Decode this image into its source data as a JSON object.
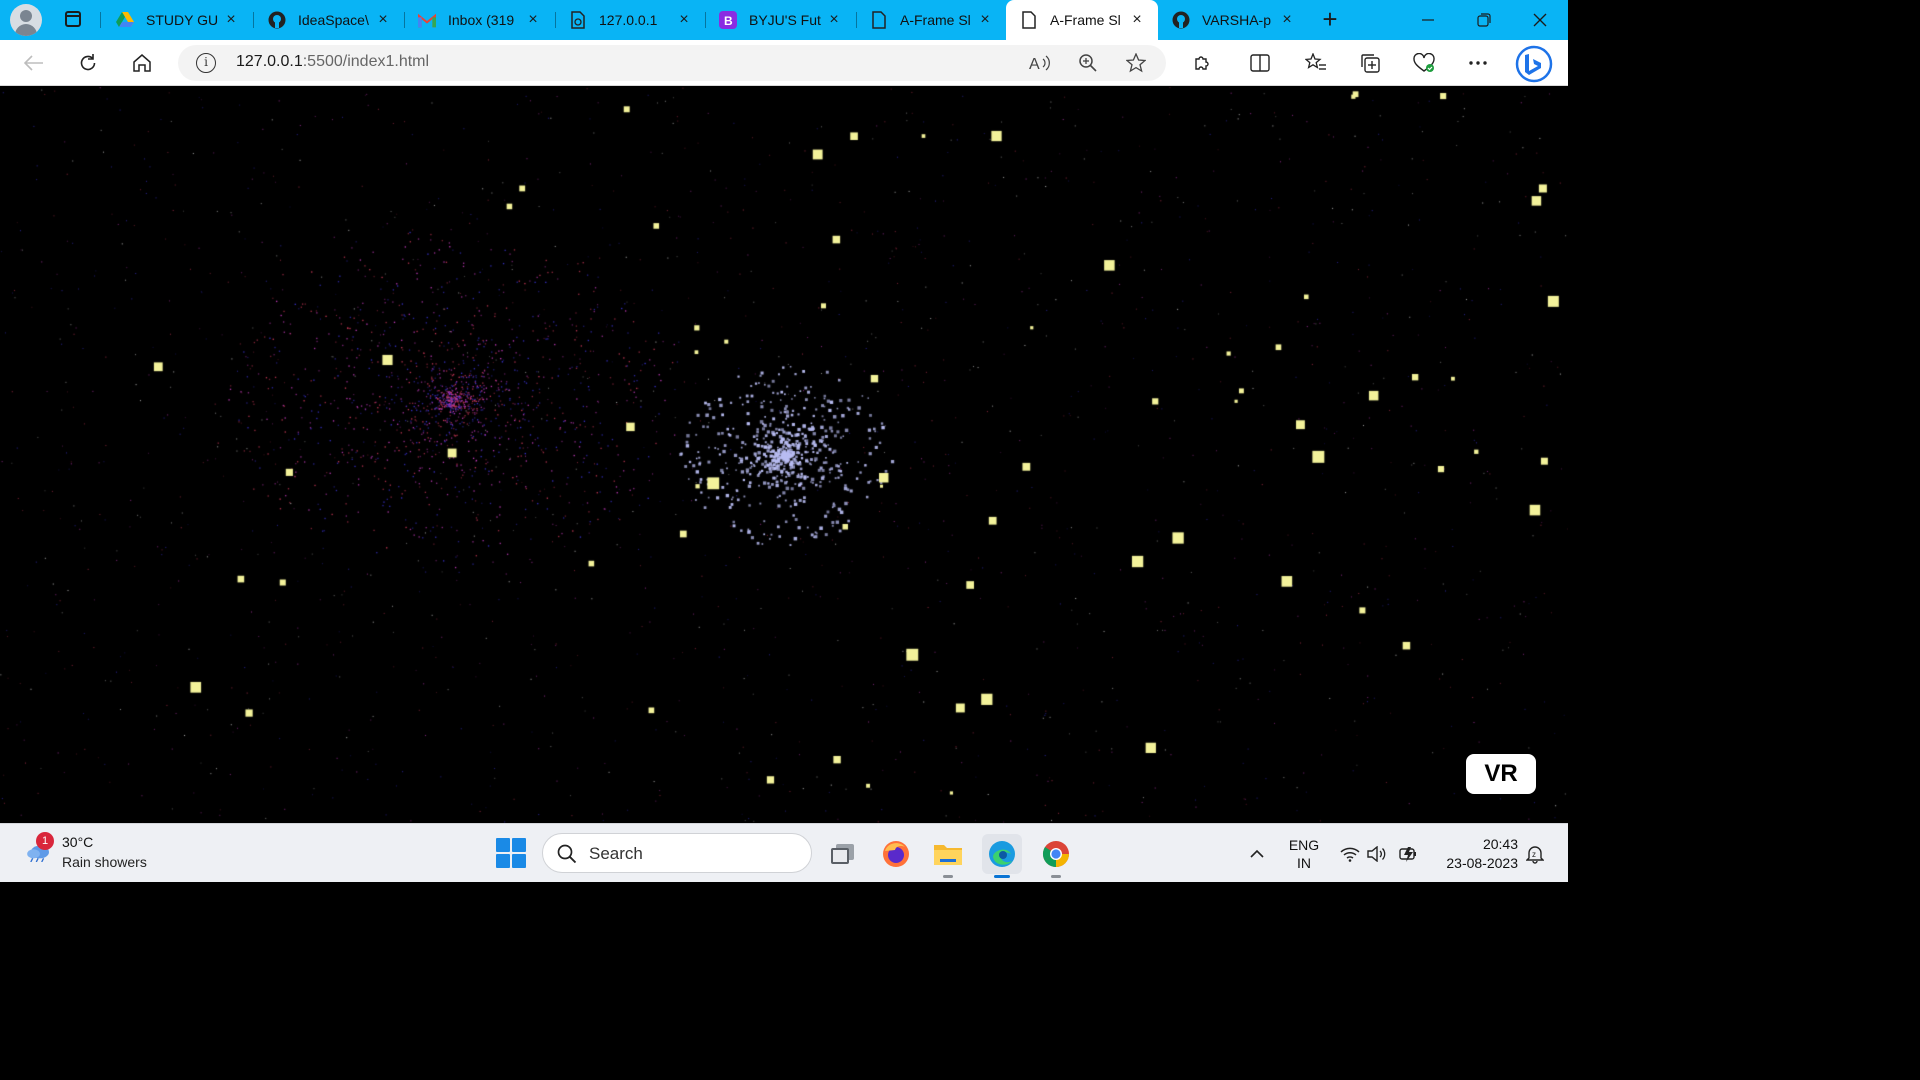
{
  "browser": {
    "tabs": [
      {
        "title": "STUDY GUI",
        "icon": "google-drive-icon",
        "active": false
      },
      {
        "title": "IdeaSpace\\",
        "icon": "github-icon",
        "active": false
      },
      {
        "title": "Inbox (319",
        "icon": "gmail-icon",
        "active": false
      },
      {
        "title": "127.0.0.1",
        "icon": "page-sync-icon",
        "active": false
      },
      {
        "title": "BYJU'S Futu",
        "icon": "byjus-icon",
        "active": false
      },
      {
        "title": "A-Frame Sl",
        "icon": "page-icon",
        "active": false
      },
      {
        "title": "A-Frame Sl",
        "icon": "page-icon",
        "active": true
      },
      {
        "title": "VARSHA-p",
        "icon": "github-icon",
        "active": false
      }
    ],
    "new_tab_label": "+",
    "close_glyph": "×",
    "address": {
      "host": "127.0.0.1",
      "rest": ":5500/index1.html"
    },
    "accent_color": "#09b4f5"
  },
  "scene": {
    "background": "#000000",
    "vr_button_label": "VR",
    "star_colors": [
      "#f3f29a",
      "#b9bdf3",
      "#c83cc0",
      "#3b34d6",
      "#d03a5a",
      "#ffffff"
    ]
  },
  "taskbar": {
    "weather": {
      "badge": "1",
      "temperature": "30°C",
      "condition": "Rain showers"
    },
    "search_placeholder": "Search",
    "language_line1": "ENG",
    "language_line2": "IN",
    "time": "20:43",
    "date": "23-08-2023"
  }
}
